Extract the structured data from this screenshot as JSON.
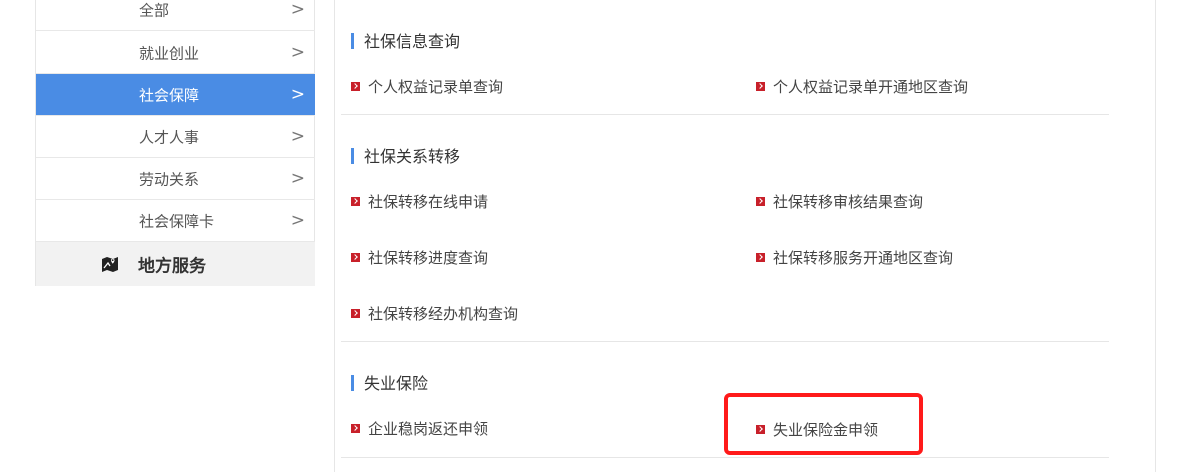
{
  "sidebar": {
    "items": [
      {
        "label": "全部",
        "chevron": ">"
      },
      {
        "label": "就业创业",
        "chevron": ">"
      },
      {
        "label": "社会保障",
        "chevron": ">",
        "active": true
      },
      {
        "label": "人才人事",
        "chevron": ">"
      },
      {
        "label": "劳动关系",
        "chevron": ">"
      },
      {
        "label": "社会保障卡",
        "chevron": ">"
      }
    ],
    "local_services": {
      "label": "地方服务",
      "icon": "map-icon"
    }
  },
  "sections": [
    {
      "title": "社保信息查询",
      "links": [
        "个人权益记录单查询",
        "个人权益记录单开通地区查询"
      ]
    },
    {
      "title": "社保关系转移",
      "links": [
        "社保转移在线申请",
        "社保转移审核结果查询",
        "社保转移进度查询",
        "社保转移服务开通地区查询",
        "社保转移经办机构查询"
      ]
    },
    {
      "title": "失业保险",
      "links": [
        "企业稳岗返还申领",
        "失业保险金申领"
      ]
    }
  ],
  "colors": {
    "accent": "#4a8ce4",
    "bullet": "#c8202a",
    "highlight": "#ff1a1a"
  }
}
